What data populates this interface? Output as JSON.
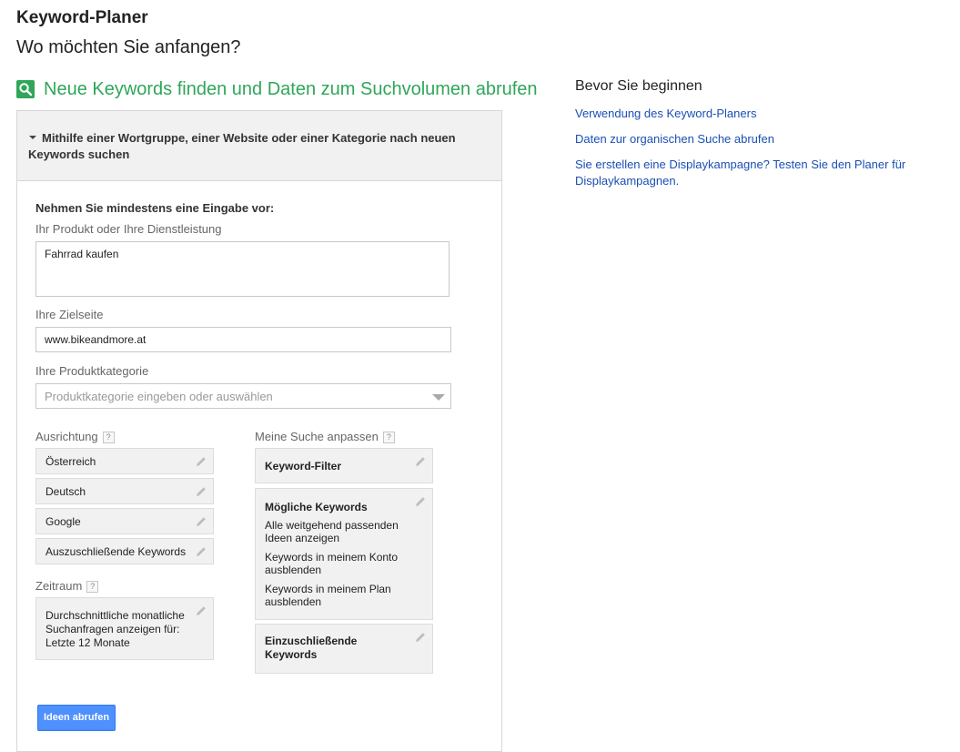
{
  "header": {
    "title": "Keyword-Planer",
    "subtitle": "Wo möchten Sie anfangen?"
  },
  "section": {
    "icon": "search-icon",
    "title": "Neue Keywords finden und Daten zum Suchvolumen abrufen",
    "accent_color": "#2fa65a"
  },
  "panel": {
    "header_text": "Mithilfe einer Wortgruppe, einer Website oder einer Kategorie nach neuen Keywords suchen",
    "instruction": "Nehmen Sie mindestens eine Eingabe vor:",
    "product_label": "Ihr Produkt oder Ihre Dienstleistung",
    "product_value": "Fahrrad kaufen",
    "landing_label": "Ihre Zielseite",
    "landing_value": "www.bikeandmore.at",
    "category_label": "Ihre Produktkategorie",
    "category_placeholder": "Produktkategorie eingeben oder auswählen",
    "targeting_label": "Ausrichtung",
    "targeting_items": [
      "Österreich",
      "Deutsch",
      "Google",
      "Auszuschließende Keywords"
    ],
    "timeframe_label": "Zeitraum",
    "timeframe_lines": [
      "Durchschnittliche monatliche",
      "Suchanfragen anzeigen für:",
      "Letzte 12 Monate"
    ],
    "customize_label": "Meine Suche anpassen",
    "keyword_filter": "Keyword-Filter",
    "keyword_options_title": "Mögliche Keywords",
    "keyword_options": [
      [
        "Alle weitgehend passenden",
        "Ideen anzeigen"
      ],
      [
        "Keywords in meinem Konto",
        "ausblenden"
      ],
      [
        "Keywords in meinem Plan",
        "ausblenden"
      ]
    ],
    "include_keywords": [
      "Einzuschließende",
      "Keywords"
    ],
    "help_mark": "?",
    "submit_label": "Ideen abrufen",
    "button_color": "#4d90fe"
  },
  "sidebar": {
    "title": "Bevor Sie beginnen",
    "links": [
      "Verwendung des Keyword-Planers",
      "Daten zur organischen Suche abrufen",
      "Sie erstellen eine Displaykampagne? Testen Sie den Planer für Displaykampagnen."
    ],
    "link_color": "#1a4fb5"
  }
}
